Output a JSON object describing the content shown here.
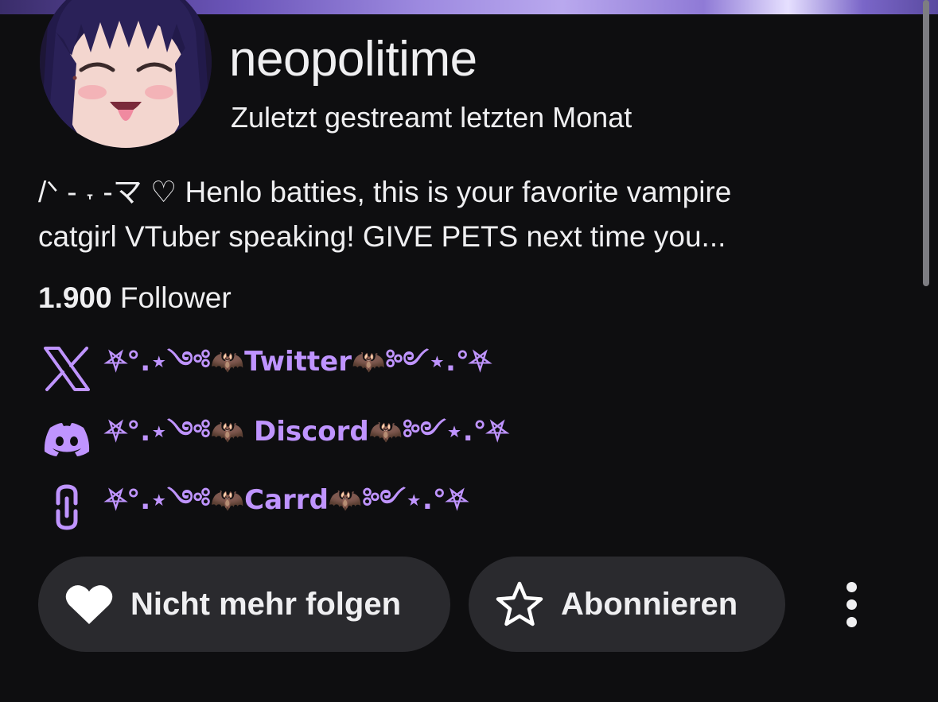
{
  "colors": {
    "background": "#0e0e10",
    "text": "#efeff1",
    "accent": "#bf94ff",
    "button_bg": "#2a2a2e"
  },
  "channel": {
    "name": "neopolitime",
    "last_streamed": "Zuletzt gestreamt letzten Monat",
    "bio_lines": [
      "/ᐠ - ˕ -マ ♡ Henlo batties, this is your favorite vampire",
      "catgirl VTuber speaking! GIVE PETS next time you..."
    ],
    "followers": {
      "count": "1.900",
      "label": "Follower"
    }
  },
  "links": [
    {
      "icon": "x-logo-icon",
      "label": "⛧°.⋆༺🦇Twitter🦇༻⋆.°⛧"
    },
    {
      "icon": "discord-icon",
      "label": "⛧°.⋆༺🦇 Discord🦇༻⋆.°⛧"
    },
    {
      "icon": "link-icon",
      "label": "⛧°.⋆༺🦇Carrd🦇༻⋆.°⛧"
    }
  ],
  "actions": {
    "unfollow": {
      "icon": "heart-icon",
      "label": "Nicht mehr folgen"
    },
    "subscribe": {
      "icon": "star-icon",
      "label": "Abonnieren"
    },
    "more": {
      "icon": "more-vertical-icon"
    }
  }
}
